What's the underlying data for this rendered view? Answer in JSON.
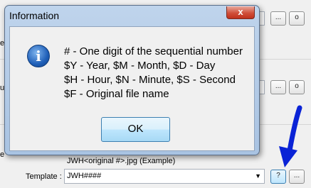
{
  "dialog": {
    "title": "Information",
    "close_glyph": "x",
    "icon": "info-icon",
    "lines": [
      "#  - One digit of the sequential number",
      "$Y - Year, $M - Month, $D - Day",
      "$H - Hour, $N - Minute, $S - Second",
      "$F - Original file name"
    ],
    "ok_label": "OK"
  },
  "background": {
    "edge_chars": [
      "e",
      "u",
      "e"
    ],
    "buttons": {
      "ellipsis": "...",
      "o": "o",
      "help": "?"
    },
    "example_text": "JWH<original #>.jpg   (Example)",
    "template_label": "Template :",
    "template_value": "JWH####"
  },
  "colors": {
    "arrow": "#0a23d6"
  }
}
